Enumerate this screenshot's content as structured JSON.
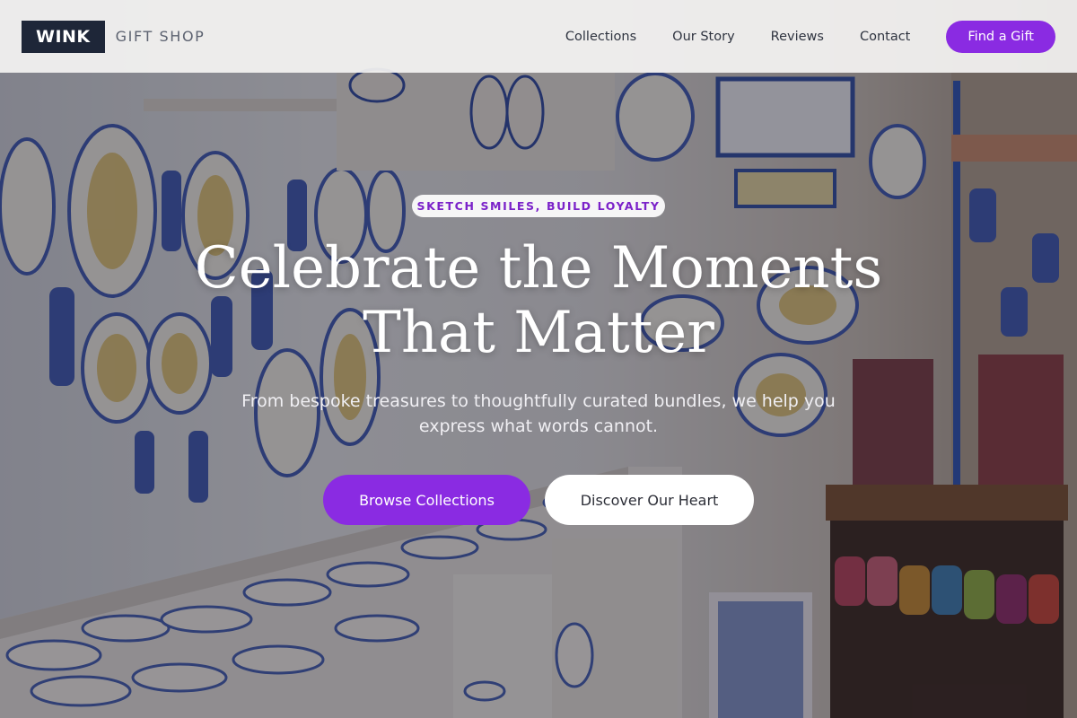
{
  "header": {
    "logo_text": "WINK",
    "logo_subtitle": "GIFT SHOP",
    "nav": [
      {
        "label": "Collections"
      },
      {
        "label": "Our Story"
      },
      {
        "label": "Reviews"
      },
      {
        "label": "Contact"
      }
    ],
    "cta_label": "Find a Gift"
  },
  "hero": {
    "tagline": "SKETCH SMILES, BUILD LOYALTY",
    "title": "Celebrate the Moments That Matter",
    "subtitle": "From bespoke treasures to thoughtfully curated bundles, we help you express what words cannot.",
    "primary_button": "Browse Collections",
    "secondary_button": "Discover Our Heart"
  },
  "colors": {
    "accent": "#8a2be2",
    "logo_bg": "#1e2638",
    "header_bg": "#f4f3f2",
    "tagline_text": "#7b22c9"
  }
}
